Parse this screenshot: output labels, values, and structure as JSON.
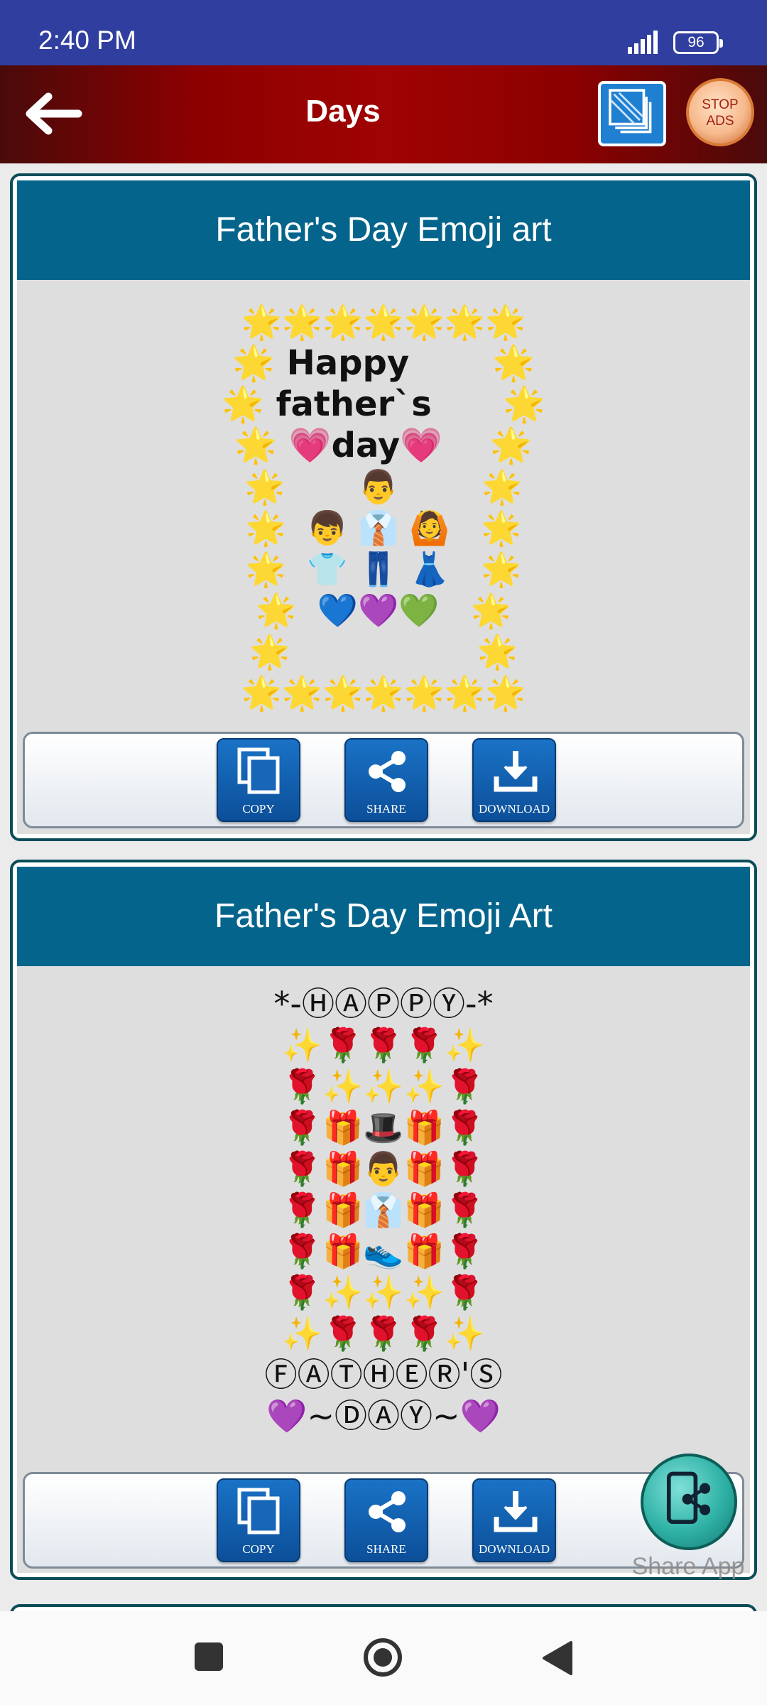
{
  "status_bar": {
    "time": "2:40 PM",
    "battery": "96"
  },
  "app_bar": {
    "title": "Days",
    "stop_ads_line1": "STOP",
    "stop_ads_line2": "ADS"
  },
  "cards": [
    {
      "title": "Father's Day Emoji art",
      "lines": [
        "🌟🌟🌟🌟🌟🌟🌟",
        "🌟 Happy       🌟",
        "🌟 father`s      🌟",
        "🌟 💗day💗    🌟",
        "🌟       👨        🌟",
        "🌟  👦 👔 🙆   🌟",
        "🌟  👕 👖 👗   🌟",
        "🌟  💙💜💚   🌟",
        "🌟                  🌟",
        "🌟🌟🌟🌟🌟🌟🌟"
      ]
    },
    {
      "title": "Father's Day Emoji Art",
      "lines": [
        "*-ⒽⒶⓅⓅⓎ-*",
        "✨🌹🌹🌹✨",
        "🌹✨✨✨🌹",
        "🌹🎁🎩🎁🌹",
        "🌹🎁👨🎁🌹",
        "🌹🎁👔🎁🌹",
        "🌹🎁👟🎁🌹",
        "🌹✨✨✨🌹",
        "✨🌹🌹🌹✨",
        "ⒻⒶⓉⒽⒺⓇ'Ⓢ",
        "💜~ⒹⒶⓎ~💜"
      ]
    }
  ],
  "actions": {
    "copy": "COPY",
    "share": "SHARE",
    "download": "DOWNLOAD"
  },
  "share_app": {
    "label": "Share App"
  },
  "icons": {
    "back": "arrow-left-icon",
    "layers": "layers-icon",
    "copy": "copy-icon",
    "share": "share-icon",
    "download": "download-icon",
    "share_app": "phone-share-icon"
  },
  "colors": {
    "status_bar": "#303f9f",
    "app_bar": "#8b0000",
    "card_header": "#05648c",
    "action_button": "#1a72c6"
  }
}
